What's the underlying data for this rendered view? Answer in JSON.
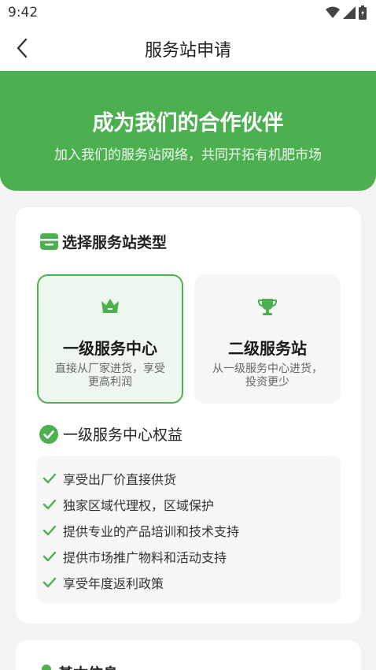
{
  "status_bar": {
    "time": "9:42"
  },
  "nav": {
    "title": "服务站申请"
  },
  "hero": {
    "title": "成为我们的合作伙伴",
    "subtitle": "加入我们的服务站网络，共同开拓有机肥市场"
  },
  "station_type": {
    "section_title": "选择服务站类型",
    "options": [
      {
        "title": "一级服务中心",
        "desc": "直接从厂家进货，享受更高利润",
        "selected": true
      },
      {
        "title": "二级服务站",
        "desc": "从一级服务中心进货，投资更少",
        "selected": false
      }
    ]
  },
  "benefits": {
    "title": "一级服务中心权益",
    "items": [
      "享受出厂价直接供货",
      "独家区域代理权，区域保护",
      "提供专业的产品培训和技术支持",
      "提供市场推广物料和活动支持",
      "享受年度返利政策"
    ]
  },
  "basic_info": {
    "title": "基本信息"
  },
  "colors": {
    "brand": "#4caf50",
    "selected_bg": "#eef7ee"
  },
  "icons": {
    "back": "chevron-left-icon",
    "store": "store-icon",
    "crown": "crown-icon",
    "trophy": "trophy-icon",
    "check_circle": "check-circle-icon",
    "check": "check-icon"
  }
}
